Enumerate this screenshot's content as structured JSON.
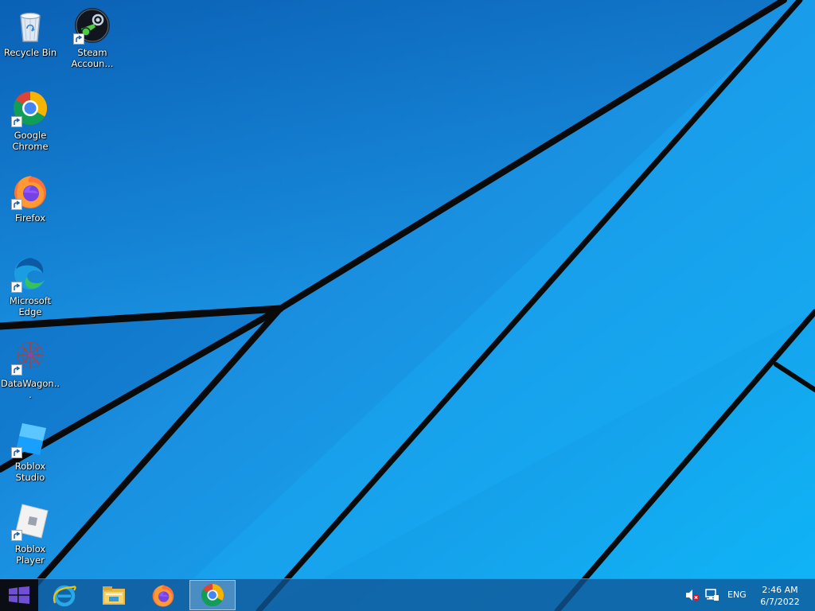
{
  "desktop": {
    "icons": [
      {
        "label": "Recycle Bin",
        "icon": "recycle-bin-icon"
      },
      {
        "label": "Steam Accoun...",
        "icon": "steam-icon"
      },
      {
        "label": "Google Chrome",
        "icon": "chrome-icon"
      },
      {
        "label": "Firefox",
        "icon": "firefox-icon"
      },
      {
        "label": "Microsoft Edge",
        "icon": "edge-icon"
      },
      {
        "label": "DataWagon...",
        "icon": "datawagon-icon"
      },
      {
        "label": "Roblox Studio",
        "icon": "roblox-studio-icon"
      },
      {
        "label": "Roblox Player",
        "icon": "roblox-player-icon"
      }
    ]
  },
  "taskbar": {
    "start": {
      "icon": "windows-logo-icon"
    },
    "pinned": [
      {
        "name": "Internet Explorer",
        "icon": "internet-explorer-icon",
        "active": false
      },
      {
        "name": "File Explorer",
        "icon": "file-explorer-icon",
        "active": false
      },
      {
        "name": "Firefox",
        "icon": "firefox-icon",
        "active": false
      },
      {
        "name": "Google Chrome",
        "icon": "chrome-icon",
        "active": true
      }
    ],
    "tray": {
      "volume_icon": "speaker-muted-icon",
      "network_icon": "network-icon",
      "language": "ENG",
      "time": "2:46 AM",
      "date": "6/7/2022"
    }
  },
  "colors": {
    "wallpaper_blue": "#1e8fe0",
    "taskbar": "#105696",
    "accent_active": "#a0c8eb"
  }
}
